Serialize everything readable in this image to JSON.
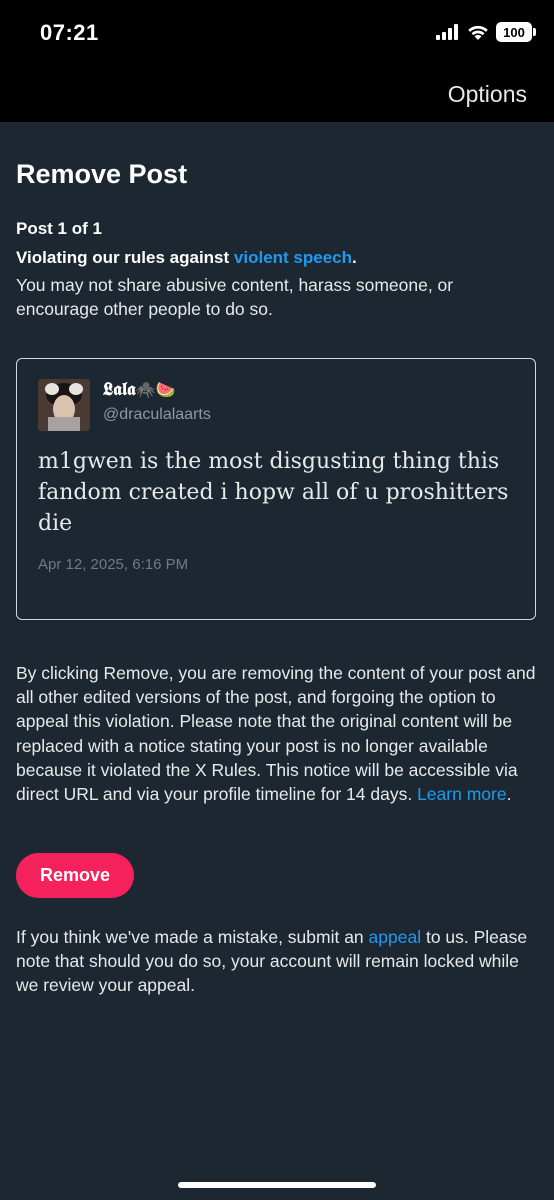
{
  "status_bar": {
    "time": "07:21",
    "battery": "100",
    "icons": [
      "cellular-signal-icon",
      "wifi-icon",
      "battery-icon"
    ]
  },
  "nav": {
    "options_label": "Options"
  },
  "page": {
    "title": "Remove Post",
    "post_count": "Post 1 of 1",
    "violation_prefix": "Violating our rules against ",
    "violation_link": "violent speech",
    "violation_suffix": ".",
    "violation_description": "You may not share abusive content, harass someone, or encourage other people to do so."
  },
  "post": {
    "display_name": "𝕷𝖆𝖑𝖆",
    "display_name_emojis": "🕷️🍉",
    "handle": "@draculalaarts",
    "text": "m1gwen is the most disgusting thing this fandom created i hopw all of u proshitters die",
    "date": "Apr 12, 2025, 6:16 PM"
  },
  "removal_notice": {
    "text": "By clicking Remove, you are removing the content of your post and all other edited versions of the post, and forgoing the option to appeal this violation. Please note that the original content will be replaced with a notice stating your post is no longer available because it violated the X Rules. This notice will be accessible via direct URL and via your profile timeline for 14 days. ",
    "learn_more_link": "Learn more",
    "suffix": "."
  },
  "actions": {
    "remove_label": "Remove"
  },
  "appeal_notice": {
    "prefix": "If you think we've made a mistake, submit an ",
    "appeal_link": "appeal",
    "suffix": " to us. Please note that should you do so, your account will remain locked while we review your appeal."
  },
  "colors": {
    "background": "#1c2732",
    "link": "#1d9bf0",
    "remove_button": "#f4215c",
    "header": "#000000"
  }
}
